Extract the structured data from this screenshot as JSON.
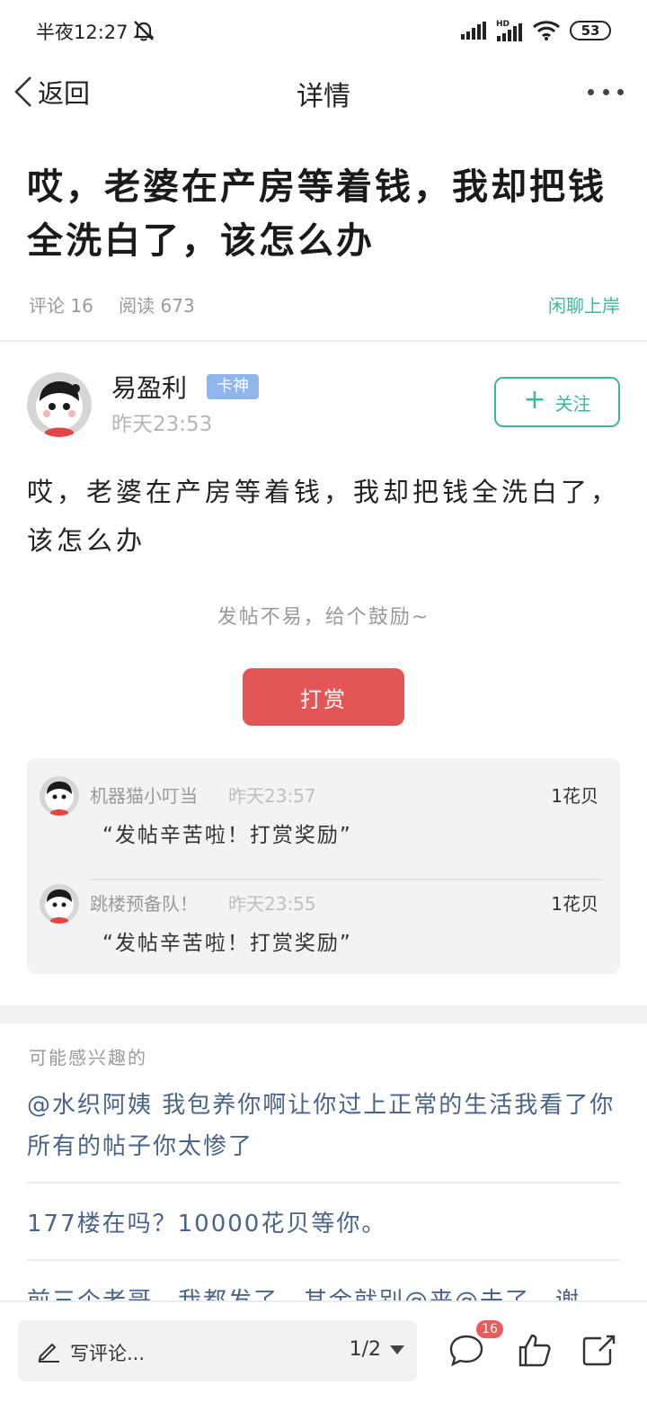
{
  "status_bar": {
    "time": "半夜12:27",
    "battery": "53"
  },
  "nav": {
    "back_label": "返回",
    "title": "详情"
  },
  "post": {
    "title": "哎，老婆在产房等着钱，我却把钱全洗白了，该怎么办",
    "comments_label": "评论 16",
    "reads_label": "阅读 673",
    "topic": "闲聊上岸",
    "body": "哎，老婆在产房等着钱，我却把钱全洗白了，该怎么办"
  },
  "author": {
    "name": "易盈利",
    "badge": "卡神",
    "time": "昨天23:53",
    "follow_label": "关注"
  },
  "reward": {
    "hint": "发帖不易，给个鼓励~",
    "button_label": "打赏",
    "tips": [
      {
        "user": "机器猫小叮当",
        "time": "昨天23:57",
        "amount": "1花贝",
        "message": "“发帖辛苦啦！打赏奖励”"
      },
      {
        "user": "跳楼预备队！",
        "time": "昨天23:55",
        "amount": "1花贝",
        "message": "“发帖辛苦啦！打赏奖励”"
      }
    ]
  },
  "related": {
    "heading": "可能感兴趣的",
    "items": [
      "@水织阿姨 我包养你啊让你过上正常的生活我看了你所有的帖子你太惨了",
      "177楼在吗？10000花贝等你。",
      "前三个老哥，我都发了，其余就别@来@去了，谢"
    ]
  },
  "bottom_bar": {
    "comment_placeholder": "写评论...",
    "page_indicator": "1/2",
    "comment_count": "16"
  },
  "colors": {
    "accent_green": "#3bb89a",
    "reward_red": "#e25656",
    "badge_blue": "#8fb5ec",
    "link_blue": "#4a6389"
  }
}
